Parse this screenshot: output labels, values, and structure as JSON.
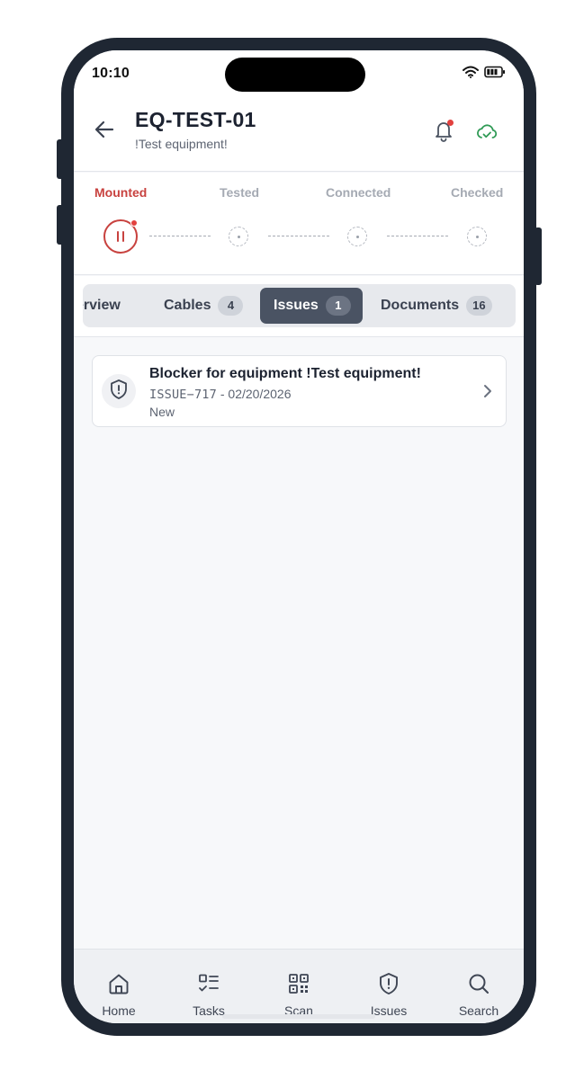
{
  "status_bar": {
    "time": "10:10"
  },
  "header": {
    "title": "EQ-TEST-01",
    "subtitle": "!Test equipment!"
  },
  "steps": [
    {
      "label": "Mounted",
      "state": "active"
    },
    {
      "label": "Tested",
      "state": "pending"
    },
    {
      "label": "Connected",
      "state": "pending"
    },
    {
      "label": "Checked",
      "state": "pending"
    }
  ],
  "tabs": [
    {
      "label": "erview",
      "count": ""
    },
    {
      "label": "Cables",
      "count": "4"
    },
    {
      "label": "Issues",
      "count": "1",
      "selected": true
    },
    {
      "label": "Documents",
      "count": "16"
    }
  ],
  "issues": [
    {
      "title": "Blocker for equipment !Test equipment!",
      "id": "ISSUE−717",
      "date": "02/20/2026",
      "separator": " - ",
      "status": "New"
    }
  ],
  "bottom_nav": [
    {
      "label": "Home",
      "icon": "home-icon"
    },
    {
      "label": "Tasks",
      "icon": "tasks-icon"
    },
    {
      "label": "Scan",
      "icon": "qr-scan-icon"
    },
    {
      "label": "Issues",
      "icon": "shield-alert-icon"
    },
    {
      "label": "Search",
      "icon": "search-icon"
    }
  ],
  "colors": {
    "accent_active": "#c8423f",
    "notification_dot": "#e2413f",
    "sync_ok": "#2f9a55",
    "tab_selected_bg": "#4a5363",
    "phone_frame": "#1f2733"
  }
}
